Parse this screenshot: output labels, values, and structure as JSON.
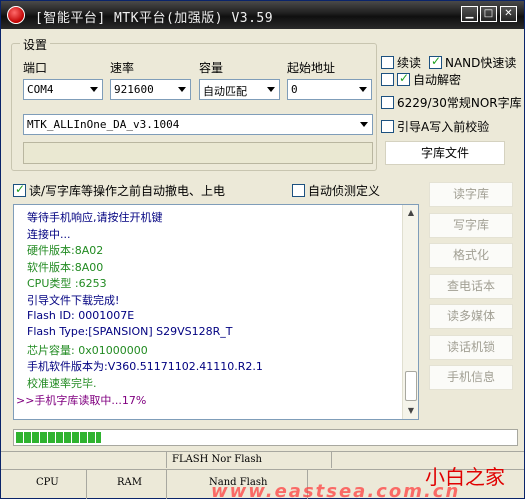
{
  "window": {
    "title": "[智能平台] MTK平台(加强版) V3.59"
  },
  "settings": {
    "legend": "设置",
    "port": {
      "label": "端口",
      "value": "COM4"
    },
    "baud": {
      "label": "速率",
      "value": "921600"
    },
    "capacity": {
      "label": "容量",
      "value": "自动匹配"
    },
    "start_addr": {
      "label": "起始地址",
      "value": "0"
    },
    "da_file": {
      "value": "MTK_ALLInOne_DA_v3.1004"
    },
    "lib_file_button": "字库文件"
  },
  "options": {
    "continue_read": {
      "label": "续读",
      "checked": false
    },
    "nand_fast_read": {
      "label": "NAND快速读",
      "checked": true
    },
    "auto_decrypt": {
      "label": "自动解密",
      "checked": true
    },
    "nor_lib": {
      "label": "6229/30常规NOR字库",
      "checked": false
    },
    "boot_verify": {
      "label": "引导A写入前校验",
      "checked": false
    },
    "auto_battery": {
      "label": "读/写字库等操作之前自动撤电、上电",
      "checked": true
    },
    "auto_detect": {
      "label": "自动侦测定义",
      "checked": false
    }
  },
  "log": [
    {
      "text": "等待手机响应,请按住开机键",
      "color": "navy"
    },
    {
      "text": "连接中...",
      "color": "navy"
    },
    {
      "text": "硬件版本:8A02",
      "color": "green"
    },
    {
      "text": "软件版本:8A00",
      "color": "green"
    },
    {
      "text": "CPU类型 :6253",
      "color": "green"
    },
    {
      "text": "引导文件下载完成!",
      "color": "navy"
    },
    {
      "text": "Flash ID: 0001007E",
      "color": "navy"
    },
    {
      "text": "Flash Type:[SPANSION] S29VS128R_T",
      "color": "navy"
    },
    {
      "text": "芯片容量: 0x01000000",
      "color": "green"
    },
    {
      "text": "手机软件版本为:V360.51171102.41110.R2.1",
      "color": "navy"
    },
    {
      "text": "校准速率完毕.",
      "color": "green"
    },
    {
      "text": ">>手机字库读取中...17%",
      "color": "purple"
    }
  ],
  "side_buttons": [
    "读字库",
    "写字库",
    "格式化",
    "查电话本",
    "读多媒体",
    "读话机锁",
    "手机信息"
  ],
  "progress": {
    "percent": 17
  },
  "status_bar": {
    "flash_info": "FLASH Nor Flash",
    "cpu": "CPU",
    "ram": "RAM",
    "nand": "Nand Flash"
  },
  "watermark": {
    "name": "小白之家",
    "url": "www.eastsea.com.cn"
  }
}
